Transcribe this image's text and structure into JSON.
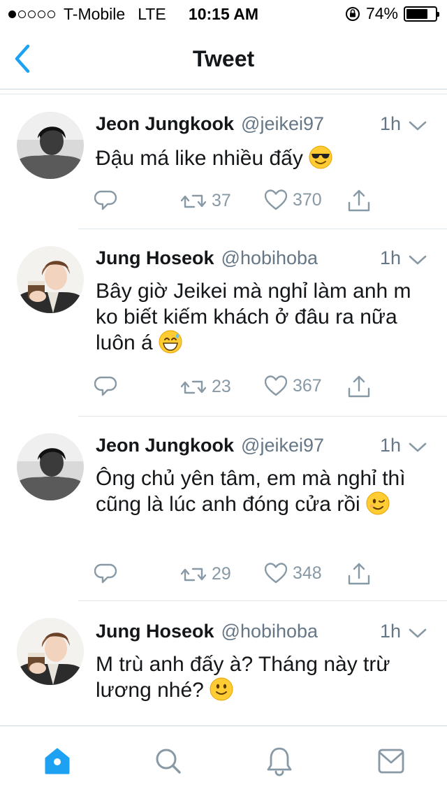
{
  "status_bar": {
    "carrier": "T-Mobile",
    "network": "LTE",
    "time": "10:15 AM",
    "battery_percent": "74%",
    "battery_level": 0.74,
    "signal_bars_filled": 1,
    "signal_bars_total": 5
  },
  "nav": {
    "title": "Tweet",
    "back_icon": "chevron-left-icon"
  },
  "colors": {
    "accent": "#1da1f2",
    "text": "#14171a",
    "muted": "#657786",
    "icon_gray": "#8899a6",
    "divider": "#e1e8ed"
  },
  "tweets": [
    {
      "name": "Jeon Jungkook",
      "handle": "@jeikei97",
      "time": "1h",
      "text": "Đậu má like nhiều đấy",
      "emoji": "smiling-face-with-sunglasses",
      "retweets": "37",
      "likes": "370"
    },
    {
      "name": "Jung Hoseok",
      "handle": "@hobihoba",
      "time": "1h",
      "text": "Bây giờ Jeikei mà nghỉ làm anh m ko biết kiếm khách ở đâu ra nữa luôn á",
      "emoji": "grinning-face-with-sweat",
      "retweets": "23",
      "likes": "367"
    },
    {
      "name": "Jeon Jungkook",
      "handle": "@jeikei97",
      "time": "1h",
      "text": "Ông chủ yên tâm, em mà nghỉ thì cũng là lúc anh đóng cửa rồi",
      "emoji": "winking-face",
      "retweets": "29",
      "likes": "348"
    },
    {
      "name": "Jung Hoseok",
      "handle": "@hobihoba",
      "time": "1h",
      "text": "M trù anh đấy à? Tháng này trừ lương nhé?",
      "emoji": "slightly-smiling-face"
    }
  ],
  "tab_bar": {
    "items": [
      "home-icon",
      "search-icon",
      "notifications-icon",
      "messages-icon"
    ],
    "active": "home-icon"
  }
}
